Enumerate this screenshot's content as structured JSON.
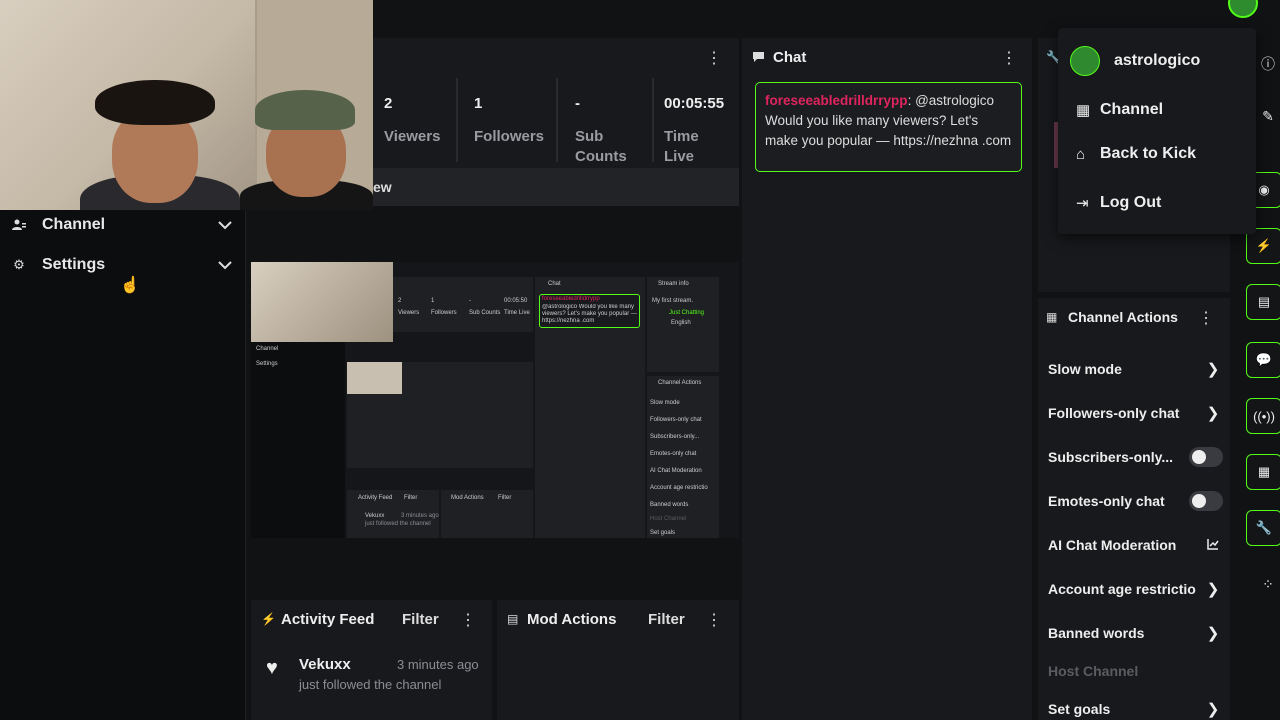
{
  "sidebar": {
    "items": [
      {
        "label": "Channel",
        "icon": "users-icon"
      },
      {
        "label": "Settings",
        "icon": "gear-icon"
      }
    ]
  },
  "stats": {
    "items": [
      {
        "value": "2",
        "label": "Viewers"
      },
      {
        "value": "1",
        "label": "Followers"
      },
      {
        "value": "-",
        "label": "Sub Counts"
      },
      {
        "value": "00:05:55",
        "label": "Time Live"
      }
    ],
    "preview_label": "ew"
  },
  "chat": {
    "title": "Chat",
    "message": {
      "user": "foreseeabledrilldrrypp",
      "text": ": @astrologico Would you like many viewers? Let's make you popular — https://nezhna .com"
    }
  },
  "profile_menu": {
    "username": "astrologico",
    "items": [
      {
        "label": "Channel",
        "icon": "channel-icon"
      },
      {
        "label": "Back to Kick",
        "icon": "home-icon"
      },
      {
        "label": "Log Out",
        "icon": "logout-icon"
      }
    ]
  },
  "channel_actions": {
    "title": "Channel Actions",
    "items": [
      {
        "label": "Slow mode",
        "control": "chevron"
      },
      {
        "label": "Followers-only chat",
        "control": "chevron"
      },
      {
        "label": "Subscribers-only...",
        "control": "toggle",
        "on": false
      },
      {
        "label": "Emotes-only chat",
        "control": "toggle",
        "on": false
      },
      {
        "label": "AI Chat Moderation",
        "control": "external"
      },
      {
        "label": "Account age restrictio",
        "control": "chevron"
      },
      {
        "label": "Banned words",
        "control": "chevron"
      },
      {
        "label": "Host Channel",
        "control": "none",
        "disabled": true
      },
      {
        "label": "Set goals",
        "control": "chevron"
      }
    ]
  },
  "activity_feed": {
    "title": "Activity Feed",
    "filter_label": "Filter",
    "entries": [
      {
        "user": "Vekuxx",
        "time": "3 minutes ago",
        "action": "just followed the channel"
      }
    ]
  },
  "mod_actions": {
    "title": "Mod Actions",
    "filter_label": "Filter"
  },
  "preview_mini": {
    "stats": [
      "2",
      "1",
      "-",
      "00:05:50"
    ],
    "stat_labels": [
      "Viewers",
      "Followers",
      "Sub Counts",
      "Time Live"
    ],
    "chat_title": "Chat",
    "chat_user": "foreseeabledrilldrrypp",
    "chat_text": "@astrologico Would you like many viewers? Let's make you popular — https://nezhna .com",
    "stream_info": "Stream info",
    "stream_title": "My first stream.",
    "category": "Just Chatting",
    "language": "English",
    "side_items": [
      "Channel",
      "Settings"
    ],
    "actions_title": "Channel Actions",
    "actions": [
      "Slow mode",
      "Followers-only chat",
      "Subscribers-only...",
      "Emotes-only chat",
      "AI Chat Moderation",
      "Account age restrictio",
      "Banned words",
      "Host Channel",
      "Set goals"
    ],
    "feed_title": "Activity Feed",
    "mod_title": "Mod Actions",
    "filter": "Filter",
    "feed_user": "Vekuxx",
    "feed_time": "3 minutes ago",
    "feed_action": "just followed the channel"
  },
  "colors": {
    "accent": "#53fc18",
    "chat_username": "#e0245e",
    "panel_bg": "#18191c",
    "page_bg": "#111214"
  }
}
